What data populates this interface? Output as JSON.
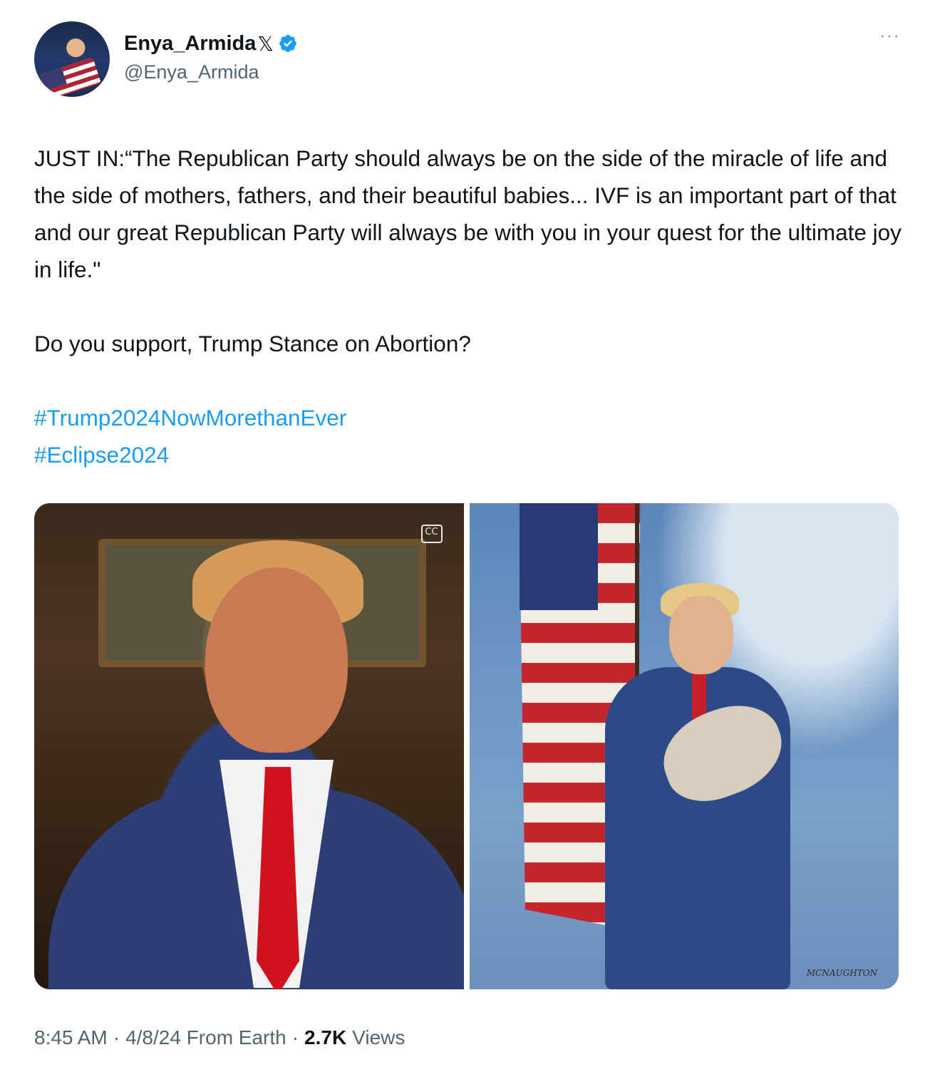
{
  "author": {
    "display_name": "Enya_Armida",
    "badge_x": "𝕏",
    "handle": "@Enya_Armida",
    "verified_color": "#1d9bf0"
  },
  "menu": {
    "more_label": "···"
  },
  "tweet": {
    "paragraph_1": "JUST IN:“The Republican Party should always be on the side of the miracle of life and the side of mothers, fathers, and their beautiful babies... IVF is an important part of that and our great Republican Party will always be with you in your quest for the ultimate joy in life.\"",
    "paragraph_2": "Do you support, Trump Stance on Abortion?",
    "hashtags": [
      "#Trump2024NowMorethanEver",
      "#Eclipse2024"
    ]
  },
  "media": {
    "cc_label": "CC",
    "signature": "MCNAUGHTON"
  },
  "meta": {
    "time": "8:45 AM",
    "sep1": "·",
    "date_source": "4/8/24 From Earth",
    "sep2": "·",
    "views_count": "2.7K",
    "views_label": "Views"
  },
  "colors": {
    "text": "#0f1419",
    "secondary": "#536471",
    "link": "#1d9bf0"
  }
}
